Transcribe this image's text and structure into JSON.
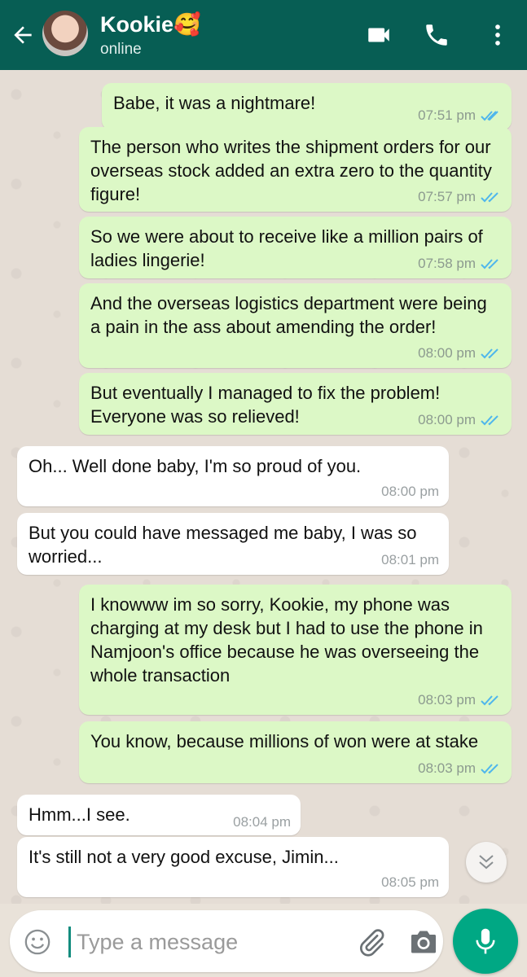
{
  "header": {
    "contact_name": "Kookie",
    "name_emoji": "🥰",
    "status": "online",
    "icons": [
      "back-arrow-icon",
      "video-call-icon",
      "voice-call-icon",
      "more-options-icon"
    ]
  },
  "messages": [
    {
      "dir": "out",
      "text": "Babe, it was a nightmare!",
      "time": "07:51 pm",
      "read": true
    },
    {
      "dir": "out",
      "text": "The person who writes the shipment orders for our overseas stock added an extra zero to the quantity figure!",
      "time": "07:57 pm",
      "read": true
    },
    {
      "dir": "out",
      "text": "So we were about to receive like a million pairs of ladies lingerie!",
      "time": "07:58 pm",
      "read": true
    },
    {
      "dir": "out",
      "text": "And the overseas logistics department were being a pain in the ass about amending the order!",
      "time": "08:00 pm",
      "read": true
    },
    {
      "dir": "out",
      "text": "But eventually I managed to fix the problem! Everyone was so relieved!",
      "time": "08:00 pm",
      "read": true
    },
    {
      "dir": "in",
      "text": "Oh... Well done baby, I'm so proud of you.",
      "time": "08:00 pm"
    },
    {
      "dir": "in",
      "text": "But you could have messaged me baby, I was so worried...",
      "time": "08:01 pm"
    },
    {
      "dir": "out",
      "text": "I knowww im so sorry, Kookie, my phone was charging at my desk but I had to use the phone in Namjoon's office because he was overseeing the whole transaction",
      "time": "08:03 pm",
      "read": true
    },
    {
      "dir": "out",
      "text": "You know, because millions of won were at stake",
      "time": "08:03 pm",
      "read": true
    },
    {
      "dir": "in",
      "text": "Hmm...I see.",
      "time": "08:04 pm"
    },
    {
      "dir": "in",
      "text": "It's still not a very good excuse, Jimin...",
      "time": "08:05 pm"
    }
  ],
  "input": {
    "placeholder": "Type a message",
    "value": ""
  },
  "colors": {
    "header": "#075e54",
    "outgoing_bubble": "#dcf8c6",
    "incoming_bubble": "#ffffff",
    "read_ticks": "#4fb6ec",
    "send_button": "#00a884"
  }
}
